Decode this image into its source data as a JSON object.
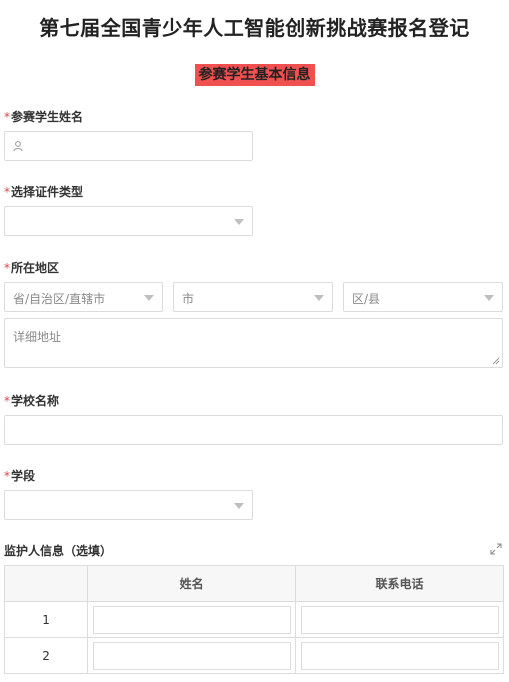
{
  "page": {
    "title": "第七届全国青少年人工智能创新挑战赛报名登记"
  },
  "section": {
    "title": "参赛学生基本信息"
  },
  "required_mark": "*",
  "fields": {
    "student_name": {
      "label": "参赛学生姓名",
      "value": "",
      "icon": "user-icon"
    },
    "id_type": {
      "label": "选择证件类型",
      "value": ""
    },
    "region": {
      "label": "所在地区",
      "province_placeholder": "省/自治区/直辖市",
      "city_placeholder": "市",
      "district_placeholder": "区/县",
      "address_placeholder": "详细地址"
    },
    "school": {
      "label": "学校名称",
      "value": ""
    },
    "stage": {
      "label": "学段",
      "value": ""
    }
  },
  "guardian": {
    "label": "监护人信息（选填）",
    "columns": [
      "",
      "姓名",
      "联系电话"
    ],
    "rows": [
      {
        "index": "1",
        "name": "",
        "phone": ""
      },
      {
        "index": "2",
        "name": "",
        "phone": ""
      }
    ]
  }
}
